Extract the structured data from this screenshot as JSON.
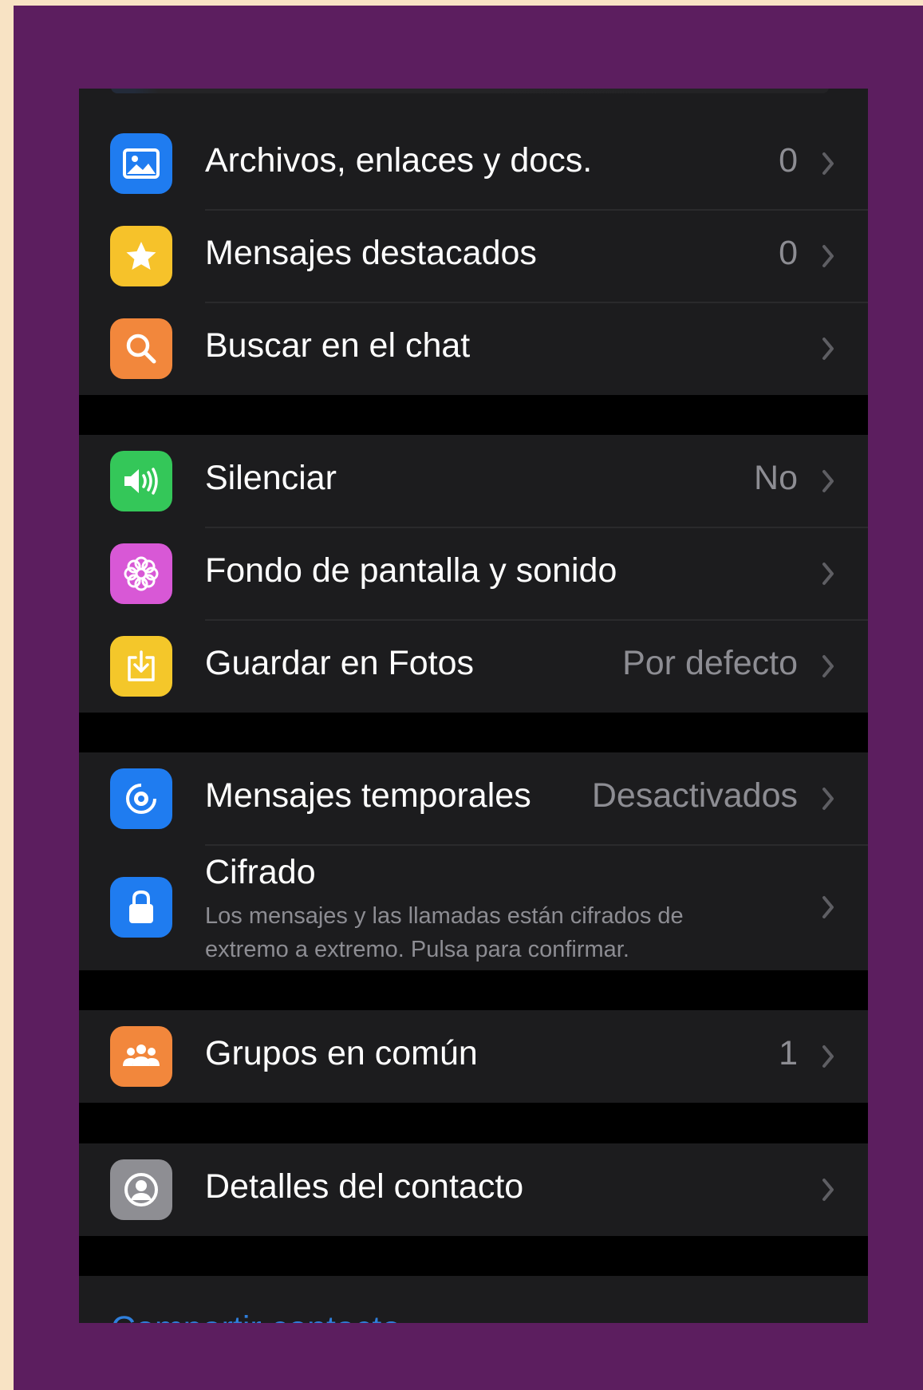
{
  "colors": {
    "page_background": "#f8e3c4",
    "frame": "#5c1e5f",
    "cell_background": "#1c1c1e",
    "list_background": "#000000",
    "secondary_text": "#8d8d93",
    "link": "#2f7fdc"
  },
  "sections": [
    {
      "rows": [
        {
          "label": "Archivos, enlaces y docs.",
          "value": "0",
          "icon": "photo-icon",
          "icon_color": "#1f7cf0"
        },
        {
          "label": "Mensajes destacados",
          "value": "0",
          "icon": "star-icon",
          "icon_color": "#f6c22a"
        },
        {
          "label": "Buscar en el chat",
          "value": "",
          "icon": "search-icon",
          "icon_color": "#f2873c"
        }
      ]
    },
    {
      "rows": [
        {
          "label": "Silenciar",
          "value": "No",
          "icon": "speaker-icon",
          "icon_color": "#34c759"
        },
        {
          "label": "Fondo de pantalla y sonido",
          "value": "",
          "icon": "flower-icon",
          "icon_color": "#d858d6"
        },
        {
          "label": "Guardar en Fotos",
          "value": "Por defecto",
          "icon": "save-icon",
          "icon_color": "#f4c72a"
        }
      ]
    },
    {
      "rows": [
        {
          "label": "Mensajes temporales",
          "value": "Desactivados",
          "icon": "timer-icon",
          "icon_color": "#1f7cf0"
        },
        {
          "label": "Cifrado",
          "subtitle_line1": "Los mensajes y las llamadas están cifrados de",
          "subtitle_line2": "extremo a extremo. Pulsa para confirmar.",
          "icon": "lock-icon",
          "icon_color": "#1f7cf0"
        }
      ]
    },
    {
      "rows": [
        {
          "label": "Grupos en común",
          "value": "1",
          "icon": "group-icon",
          "icon_color": "#f2873c"
        }
      ]
    },
    {
      "rows": [
        {
          "label": "Detalles del contacto",
          "value": "",
          "icon": "contact-icon",
          "icon_color": "#8e8e93"
        }
      ]
    }
  ],
  "share_contact_link": "Compartir contacto"
}
